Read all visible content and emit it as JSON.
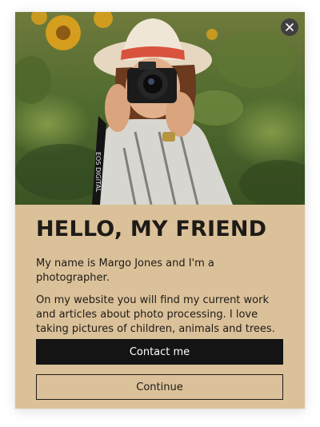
{
  "popup": {
    "close_icon": "close-icon",
    "photo_label": "EOS DIGITAL",
    "title": "HELLO, MY FRIEND",
    "paragraph_1": "My name is Margo Jones and I'm a photographer.",
    "paragraph_2": "On my website you will find my current work and articles about photo processing. I love taking pictures of children, animals and trees.",
    "primary_button": "Contact me",
    "secondary_button": "Continue"
  },
  "colors": {
    "panel_background": "#dbc199",
    "primary_button_bg": "#141414",
    "text": "#1e1b17",
    "close_button_bg": "#3f3f3f"
  }
}
